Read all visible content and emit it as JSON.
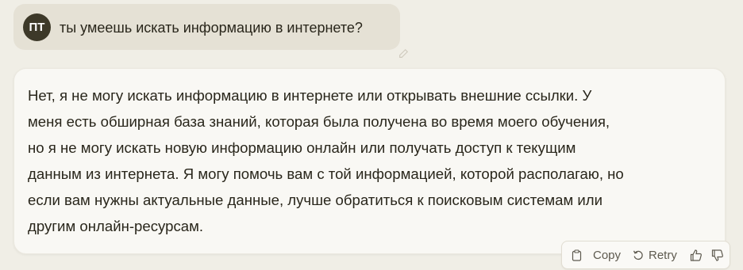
{
  "user_message": {
    "avatar_initials": "ПТ",
    "text": "ты умеешь искать информацию в интернете?",
    "edit_icon": "pencil-icon"
  },
  "assistant_message": {
    "lines": [
      "Нет, я не могу искать информацию в интернете или открывать внешние ссылки. У",
      "меня есть обширная база знаний, которая была получена во время моего обучения,",
      "но я не могу искать новую информацию онлайн или получать доступ к текущим",
      "данным из интернета. Я могу помочь вам с той информацией, которой располагаю, но",
      "если вам нужны актуальные данные, лучше обратиться к поисковым системам или",
      "другим онлайн-ресурсам."
    ]
  },
  "actions": {
    "copy_label": "Copy",
    "copy_icon": "clipboard-icon",
    "retry_label": "Retry",
    "retry_icon": "retry-icon",
    "thumbs_up_icon": "thumbs-up-icon",
    "thumbs_down_icon": "thumbs-down-icon"
  },
  "colors": {
    "background": "#f0eee6",
    "user_bubble": "#e5e1d5",
    "assistant_bubble": "#f9f8f4",
    "avatar": "#3d3929",
    "text": "#29261b"
  }
}
